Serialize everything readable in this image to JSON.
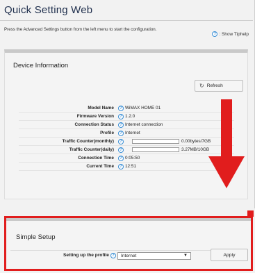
{
  "app": {
    "title": "Quick Setting Web"
  },
  "header": {
    "instruction": "Press the Advanced Settings button from the left menu to start the configuration.",
    "tiphelp_label": ": Show Tiphelp"
  },
  "device_info": {
    "title": "Device Information",
    "refresh_label": "Refresh",
    "rows": [
      {
        "label": "Model Name",
        "value": "WiMAX HOME 01"
      },
      {
        "label": "Firmware Version",
        "value": "1.2.0"
      },
      {
        "label": "Connection Status",
        "value": "Internet connection"
      },
      {
        "label": "Profile",
        "value": "Internet"
      },
      {
        "label": "Traffic Counter(monthly)",
        "value": "0.00bytes/7GB",
        "usage_fraction": 0.0
      },
      {
        "label": "Traffic Counter(daily)",
        "value": "3.27MB/10GB",
        "usage_fraction": 0.0
      },
      {
        "label": "Connection Time",
        "value": "0:05:50"
      },
      {
        "label": "Current Time",
        "value": "12:51"
      }
    ]
  },
  "simple_setup": {
    "title": "Simple Setup",
    "profile_label": "Setting up the profile",
    "profile_selected": "Internet",
    "apply_label": "Apply"
  },
  "colors": {
    "accent": "#e11d1d",
    "help": "#3a8fd6",
    "title": "#1e2e4c"
  },
  "icons": [
    "help-icon",
    "refresh-icon",
    "down-arrow-annotation-icon",
    "caret-down-icon"
  ]
}
